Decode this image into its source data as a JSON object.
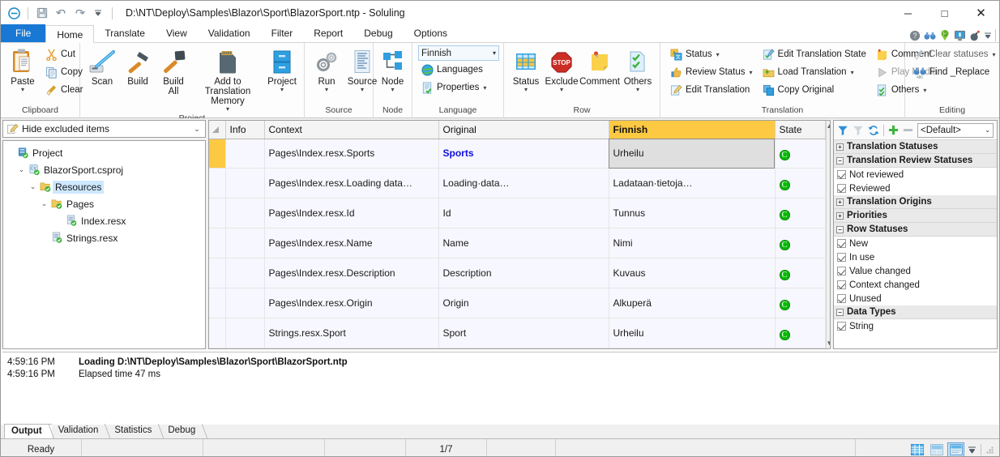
{
  "window": {
    "title": "D:\\NT\\Deploy\\Samples\\Blazor\\Sport\\BlazorSport.ntp  -  Soluling",
    "minimize": "─",
    "maximize": "□",
    "close": "✕",
    "quick_access": [
      {
        "name": "app-menu-icon",
        "glyph": "app"
      },
      {
        "name": "save-icon",
        "glyph": "save"
      },
      {
        "name": "undo-icon",
        "glyph": "undo"
      },
      {
        "name": "redo-icon",
        "glyph": "redo"
      },
      {
        "name": "qat-more-icon",
        "glyph": "caret"
      }
    ],
    "help_icons": [
      {
        "name": "help-icon"
      },
      {
        "name": "binoculars-icon"
      },
      {
        "name": "globe-pin-icon"
      },
      {
        "name": "monitor-icon"
      },
      {
        "name": "bomb-icon"
      },
      {
        "name": "ribbon-options-icon"
      }
    ]
  },
  "tabs": [
    {
      "label": "File",
      "style": "file"
    },
    {
      "label": "Home",
      "style": "active"
    },
    {
      "label": "Translate",
      "style": "normal"
    },
    {
      "label": "View",
      "style": "normal"
    },
    {
      "label": "Validation",
      "style": "normal"
    },
    {
      "label": "Filter",
      "style": "normal"
    },
    {
      "label": "Report",
      "style": "normal"
    },
    {
      "label": "Debug",
      "style": "normal"
    },
    {
      "label": "Options",
      "style": "normal"
    }
  ],
  "ribbon": {
    "groups": {
      "clipboard": {
        "label": "Clipboard",
        "paste": "Paste",
        "cut": "Cut",
        "copy": "Copy",
        "clear": "Clear"
      },
      "project": {
        "label": "Project",
        "scan": "Scan",
        "build": "Build",
        "build_all": "Build\nAll",
        "add_to_tm": "Add to Translation\nMemory",
        "project": "Project"
      },
      "source": {
        "label": "Source",
        "run": "Run",
        "source": "Source"
      },
      "node": {
        "label": "Node",
        "node": "Node"
      },
      "language": {
        "label": "Language",
        "selected_language": "Finnish",
        "languages": "Languages",
        "properties": "Properties"
      },
      "row": {
        "label": "Row",
        "status": "Status",
        "exclude": "Exclude",
        "comment": "Comment",
        "others": "Others"
      },
      "translation": {
        "label": "Translation",
        "status": "Status",
        "review_status": "Review Status",
        "edit_translation": "Edit Translation",
        "edit_translation_state": "Edit Translation State",
        "load_translation": "Load Translation",
        "copy_original": "Copy Original",
        "comment": "Comment",
        "play_media": "Play Media",
        "others": "Others"
      },
      "editing": {
        "label": "Editing",
        "clear_statuses": "Clear statuses",
        "find_replace": "Find _Replace"
      }
    }
  },
  "tree": {
    "filter_value": "Hide excluded items",
    "nodes": [
      {
        "label": "Project",
        "indent": 0,
        "expander": "",
        "icon": "project-icon",
        "selected": false
      },
      {
        "label": "BlazorSport.csproj",
        "indent": 1,
        "expander": "⌄",
        "icon": "csproj-icon",
        "selected": false
      },
      {
        "label": "Resources",
        "indent": 2,
        "expander": "⌄",
        "icon": "folder-icon",
        "selected": true
      },
      {
        "label": "Pages",
        "indent": 3,
        "expander": "⌄",
        "icon": "folder-icon",
        "selected": false
      },
      {
        "label": "Index.resx",
        "indent": 4,
        "expander": "",
        "icon": "resx-icon",
        "selected": false
      },
      {
        "label": "Strings.resx",
        "indent": 3,
        "expander": "",
        "icon": "resx-icon",
        "selected": false
      }
    ]
  },
  "grid": {
    "columns": [
      "Info",
      "Context",
      "Original",
      "Finnish",
      "State"
    ],
    "rows": [
      {
        "info": "",
        "context": "Pages\\Index.resx.Sports",
        "original": "Sports",
        "original_keyword": true,
        "finnish": "Urheilu",
        "state": "C",
        "selected": true
      },
      {
        "info": "",
        "context": "Pages\\Index.resx.Loading data…",
        "original": "Loading·data…",
        "original_keyword": false,
        "finnish": "Ladataan·tietoja…",
        "state": "C",
        "selected": false
      },
      {
        "info": "",
        "context": "Pages\\Index.resx.Id",
        "original": "Id",
        "original_keyword": false,
        "finnish": "Tunnus",
        "state": "C",
        "selected": false
      },
      {
        "info": "",
        "context": "Pages\\Index.resx.Name",
        "original": "Name",
        "original_keyword": false,
        "finnish": "Nimi",
        "state": "C",
        "selected": false
      },
      {
        "info": "",
        "context": "Pages\\Index.resx.Description",
        "original": "Description",
        "original_keyword": false,
        "finnish": "Kuvaus",
        "state": "C",
        "selected": false
      },
      {
        "info": "",
        "context": "Pages\\Index.resx.Origin",
        "original": "Origin",
        "original_keyword": false,
        "finnish": "Alkuperä",
        "state": "C",
        "selected": false
      },
      {
        "info": "",
        "context": "Strings.resx.Sport",
        "original": "Sport",
        "original_keyword": false,
        "finnish": "Urheilu",
        "state": "C",
        "selected": false
      }
    ]
  },
  "filter_pane": {
    "preset": "<Default>",
    "toolbar": [
      {
        "name": "apply-filter-icon"
      },
      {
        "name": "clear-filter-icon"
      },
      {
        "name": "refresh-filter-icon"
      },
      {
        "name": "add-filter-icon"
      },
      {
        "name": "remove-filter-icon"
      }
    ],
    "groups": [
      {
        "title": "Translation Statuses",
        "expanded": false,
        "items": []
      },
      {
        "title": "Translation Review Statuses",
        "expanded": true,
        "items": [
          {
            "label": "Not reviewed",
            "checked": true
          },
          {
            "label": "Reviewed",
            "checked": true
          }
        ]
      },
      {
        "title": "Translation Origins",
        "expanded": false,
        "items": []
      },
      {
        "title": "Priorities",
        "expanded": false,
        "items": []
      },
      {
        "title": "Row Statuses",
        "expanded": true,
        "items": [
          {
            "label": "New",
            "checked": true
          },
          {
            "label": "In use",
            "checked": true
          },
          {
            "label": "Value changed",
            "checked": true
          },
          {
            "label": "Context changed",
            "checked": true
          },
          {
            "label": "Unused",
            "checked": true
          }
        ]
      },
      {
        "title": "Data Types",
        "expanded": true,
        "items": [
          {
            "label": "String",
            "checked": true
          }
        ]
      }
    ]
  },
  "output": {
    "log": [
      {
        "time": "4:59:16 PM",
        "message": "Loading D:\\NT\\Deploy\\Samples\\Blazor\\Sport\\BlazorSport.ntp",
        "bold": true
      },
      {
        "time": "4:59:16 PM",
        "message": "Elapsed time 47 ms",
        "bold": false
      }
    ],
    "tabs": [
      {
        "label": "Output",
        "active": true
      },
      {
        "label": "Validation",
        "active": false
      },
      {
        "label": "Statistics",
        "active": false
      },
      {
        "label": "Debug",
        "active": false
      }
    ]
  },
  "statusbar": {
    "ready": "Ready",
    "cell2": "",
    "cell3": "",
    "cell4": "",
    "position": "1/7",
    "cell6": "",
    "view_buttons": [
      {
        "name": "view-grid-button",
        "selected": false
      },
      {
        "name": "view-split-button",
        "selected": false
      },
      {
        "name": "view-form-button",
        "selected": true
      }
    ],
    "view_dropdown": "view-layout-dropdown"
  },
  "colors": {
    "accent_blue": "#1978d4",
    "target_column": "#fdc943",
    "state_green": "#0ab80a",
    "selection_blue": "#cde8ff",
    "keyword_blue": "#1010e0"
  }
}
